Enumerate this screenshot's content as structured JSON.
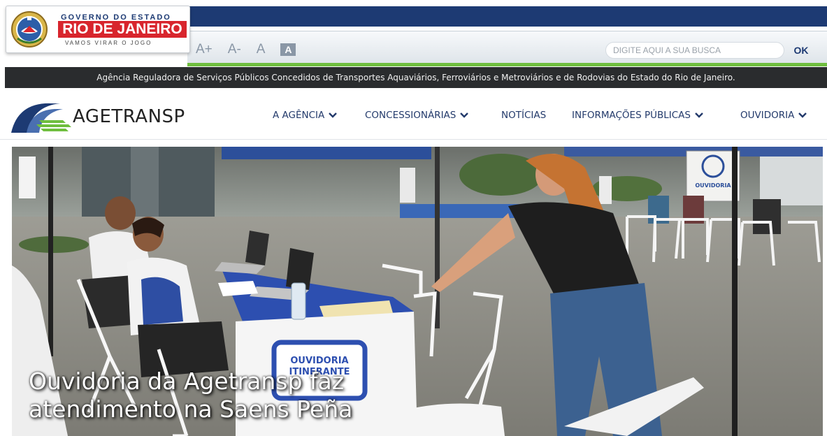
{
  "gov_header": {
    "line1": "GOVERNO DO ESTADO",
    "line2": "RIO DE JANEIRO",
    "line3": "VAMOS VIRAR O JOGO"
  },
  "font_tools": {
    "increase": "A+",
    "decrease": "A-",
    "normal": "A",
    "contrast": "A"
  },
  "search": {
    "placeholder": "DIGITE AQUI A SUA BUSCA",
    "button": "OK"
  },
  "agency_description": "Agência Reguladora de Serviços Públicos Concedidos de Transportes Aquaviários, Ferroviários e Metroviários e de Rodovias do Estado do Rio de Janeiro.",
  "brand": {
    "name": "AGETRANSP"
  },
  "nav": {
    "items": [
      {
        "label": "A AGÊNCIA",
        "dropdown": true
      },
      {
        "label": "CONCESSIONÁRIAS",
        "dropdown": true
      },
      {
        "label": "NOTÍCIAS",
        "dropdown": false
      },
      {
        "label": "INFORMAÇÕES PÚBLICAS",
        "dropdown": true
      },
      {
        "label": "OUVIDORIA",
        "dropdown": true
      }
    ]
  },
  "hero": {
    "title_line1": "Ouvidoria da Agetransp faz",
    "title_line2": "atendimento na Saens Peña",
    "sign_text": "OUVIDORIA ITINERANTE",
    "banner_text": "OUVIDORIA ITINERANTE"
  },
  "colors": {
    "gov_blue": "#1d3a73",
    "gov_red": "#d8252d",
    "gov_green": "#6fbe3e",
    "nav_text": "#233a6b",
    "strip_bg": "#2a2c2e"
  }
}
